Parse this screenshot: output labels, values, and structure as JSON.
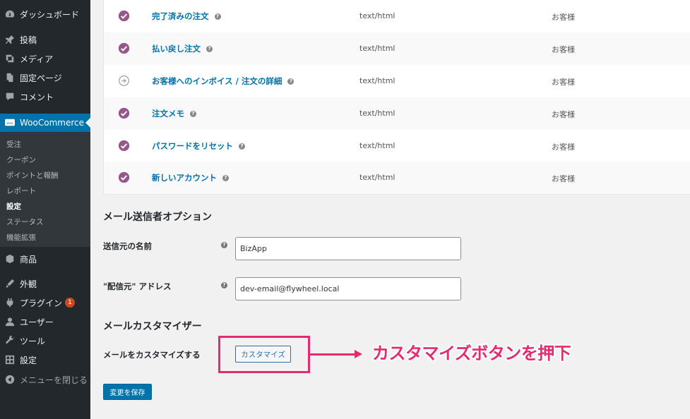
{
  "sidebar": {
    "menu": [
      {
        "label": "ダッシュボード",
        "icon": "dashboard-icon"
      },
      {
        "label": "投稿",
        "icon": "pin-icon"
      },
      {
        "label": "メディア",
        "icon": "media-icon"
      },
      {
        "label": "固定ページ",
        "icon": "page-icon"
      },
      {
        "label": "コメント",
        "icon": "comment-icon"
      },
      {
        "label": "WooCommerce",
        "icon": "woo-icon"
      },
      {
        "label": "商品",
        "icon": "product-icon"
      },
      {
        "label": "外観",
        "icon": "appearance-icon"
      },
      {
        "label": "プラグイン",
        "icon": "plugin-icon",
        "badge": "1"
      },
      {
        "label": "ユーザー",
        "icon": "user-icon"
      },
      {
        "label": "ツール",
        "icon": "tool-icon"
      },
      {
        "label": "設定",
        "icon": "settings-icon"
      },
      {
        "label": "メニューを閉じる",
        "icon": "collapse-icon"
      }
    ],
    "woo_submenu": [
      {
        "label": "受注"
      },
      {
        "label": "クーポン"
      },
      {
        "label": "ポイントと報酬"
      },
      {
        "label": "レポート"
      },
      {
        "label": "設定",
        "current": true
      },
      {
        "label": "ステータス"
      },
      {
        "label": "機能拡張"
      }
    ]
  },
  "emails": [
    {
      "name": "完了済みの注文",
      "content_type": "text/html",
      "recipient": "お客様",
      "status": "enabled"
    },
    {
      "name": "払い戻し注文",
      "content_type": "text/html",
      "recipient": "お客様",
      "status": "enabled"
    },
    {
      "name": "お客様へのインボイス / 注文の詳細",
      "content_type": "text/html",
      "recipient": "お客様",
      "status": "manual"
    },
    {
      "name": "注文メモ",
      "content_type": "text/html",
      "recipient": "お客様",
      "status": "enabled"
    },
    {
      "name": "パスワードをリセット",
      "content_type": "text/html",
      "recipient": "お客様",
      "status": "enabled"
    },
    {
      "name": "新しいアカウント",
      "content_type": "text/html",
      "recipient": "お客様",
      "status": "enabled"
    }
  ],
  "sender_options": {
    "title": "メール送信者オプション",
    "from_name_label": "送信元の名前",
    "from_name_value": "BizApp",
    "from_address_label": "\"配信元\" アドレス",
    "from_address_value": "dev-email@flywheel.local"
  },
  "customizer": {
    "title": "メールカスタマイザー",
    "label": "メールをカスタマイズする",
    "button_label": "カスタマイズ"
  },
  "annotation": {
    "callout_text": "カスタマイズボタンを押下",
    "color": "#e32b6e"
  },
  "save_button_label": "変更を保存",
  "colors": {
    "sidebar_bg": "#23282d",
    "active_menu": "#0073aa",
    "enabled_icon": "#96588a",
    "link": "#0073aa"
  }
}
